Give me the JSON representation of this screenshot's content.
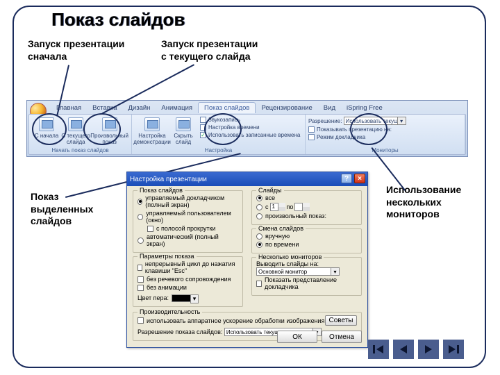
{
  "title": "Показ слайдов",
  "annotations": {
    "a1": "Запуск презентации\nсначала",
    "a2": "Запуск презентации\nс текущего слайда",
    "a3": "Показ\nвыделенных\nслайдов",
    "a4": "Использование\nнескольких\nмониторов"
  },
  "ribbon": {
    "tabs": [
      "Главная",
      "Вставка",
      "Дизайн",
      "Анимация",
      "Показ слайдов",
      "Рецензирование",
      "Вид",
      "iSpring Free"
    ],
    "active": 4,
    "g1": {
      "b1": "С начала",
      "b2": "С текущего слайда",
      "b3": "Произвольный показ",
      "label": "Начать показ слайдов"
    },
    "g2": {
      "b1": "Настройка демонстрации",
      "b2": "Скрыть слайд",
      "c1": "Звукозапись",
      "c2": "Настройка времени",
      "c3": "Использовать записанные времена",
      "label": "Настройка"
    },
    "g3": {
      "l1": "Разрешение:",
      "v1": "Использовать текуще...",
      "c1": "Показывать презентацию на:",
      "c2": "Режим докладчика",
      "label": "Мониторы"
    }
  },
  "dialog": {
    "title": "Настройка презентации",
    "fs1": {
      "legend": "Показ слайдов",
      "r1": "управляемый докладчиком (полный экран)",
      "r2": "управляемый пользователем (окно)",
      "c1": "с полосой прокрутки",
      "r3": "автоматический (полный экран)"
    },
    "fs2": {
      "legend": "Слайды",
      "r1": "все",
      "r2l": "с",
      "r2m": "по",
      "v1": "1",
      "r3": "произвольный показ:"
    },
    "fs3": {
      "legend": "Параметры показа",
      "c1": "непрерывный цикл до нажатия клавиши \"Esc\"",
      "c2": "без речевого сопровождения",
      "c3": "без анимации",
      "pen": "Цвет пера:"
    },
    "fs4": {
      "legend": "Смена слайдов",
      "r1": "вручную",
      "r2": "по времени"
    },
    "fs5": {
      "legend": "Несколько мониторов",
      "l1": "Выводить слайды на:",
      "v1": "Основной монитор",
      "c1": "Показать представление докладчика"
    },
    "fs6": {
      "legend": "Производительность",
      "c1": "использовать аппаратное ускорение обработки изображения",
      "tip": "Советы",
      "l1": "Разрешение показа слайдов:",
      "v1": "Использовать текущее разрешение"
    },
    "ok": "ОК",
    "cancel": "Отмена"
  }
}
